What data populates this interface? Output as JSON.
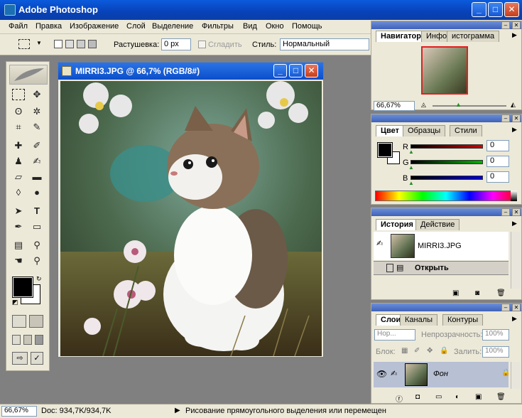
{
  "app": {
    "title": "Adobe Photoshop"
  },
  "menu": [
    "Файл",
    "Правка",
    "Изображение",
    "Слой",
    "Выделение",
    "Фильтры",
    "Вид",
    "Окно",
    "Помощь"
  ],
  "options": {
    "feather_label": "Растушевка:",
    "feather_value": "0 px",
    "antialias_label": "Сгладить",
    "style_label": "Стиль:",
    "style_value": "Нормальный"
  },
  "document": {
    "title": "MIRRI3.JPG @ 66,7% (RGB/8#)"
  },
  "navigator": {
    "tabs": [
      "Навигатор",
      "Инфо",
      "истограмма"
    ],
    "zoom": "66,67%"
  },
  "color": {
    "tabs": [
      "Цвет",
      "Образцы",
      "Стили"
    ],
    "channels": [
      {
        "label": "R",
        "value": "0",
        "color": "#d00000"
      },
      {
        "label": "G",
        "value": "0",
        "color": "#00b000"
      },
      {
        "label": "B",
        "value": "0",
        "color": "#0000d0"
      }
    ]
  },
  "history": {
    "tabs": [
      "История",
      "Действие"
    ],
    "snapshot": "MIRRI3.JPG",
    "step": "Открыть"
  },
  "layers": {
    "tabs": [
      "Слои",
      "Каналы",
      "Контуры"
    ],
    "blend_mode": "Нор...",
    "opacity_label": "Непрозрачность:",
    "opacity_value": "100%",
    "lock_label": "Блок:",
    "fill_label": "Залить:",
    "fill_value": "100%",
    "layer_name": "Фон"
  },
  "status": {
    "zoom": "66,67%",
    "doc": "Doc: 934,7K/934,7K",
    "hint": "Рисование прямоугольного выделения или перемещен"
  }
}
